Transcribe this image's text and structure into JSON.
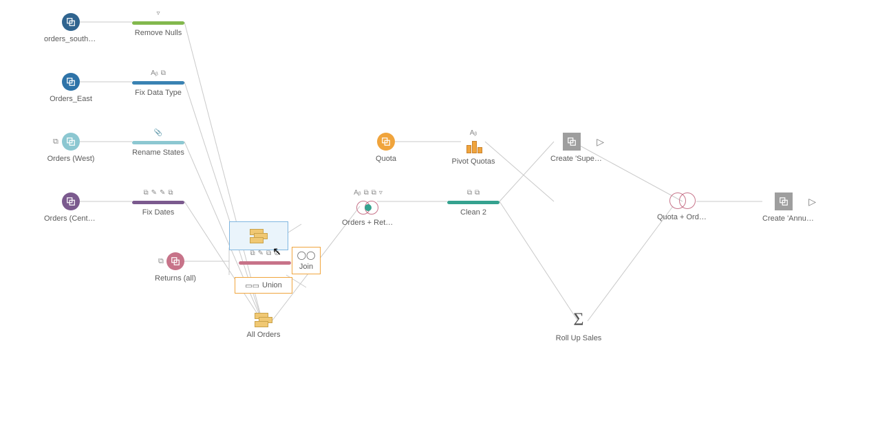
{
  "inputs": {
    "south": "orders_south_...",
    "east": "Orders_East",
    "west": "Orders (West)",
    "central": "Orders (Central)",
    "returns": "Returns (all)",
    "quota": "Quota"
  },
  "clean": {
    "removeNulls": "Remove Nulls",
    "fixDataType": "Fix Data Type",
    "renameStates": "Rename States",
    "fixDates": "Fix Dates",
    "clean2": "Clean 2"
  },
  "steps": {
    "allOrders": "All Orders",
    "ordersReturns": "Orders + Returns",
    "pivotQuotas": "Pivot Quotas",
    "rollUp": "Roll Up Sales",
    "quotaOrders": "Quota + Orders"
  },
  "outputs": {
    "supers": "Create 'Supers...",
    "annual": "Create 'Annual ..."
  },
  "dropzone": {
    "union": "Union",
    "join": "Join"
  },
  "icons": {
    "filter": "filter-icon",
    "rename": "rename-icon",
    "calc": "calc-icon",
    "attach": "attach-icon",
    "sigma": "sigma-icon",
    "play": "play-icon"
  }
}
